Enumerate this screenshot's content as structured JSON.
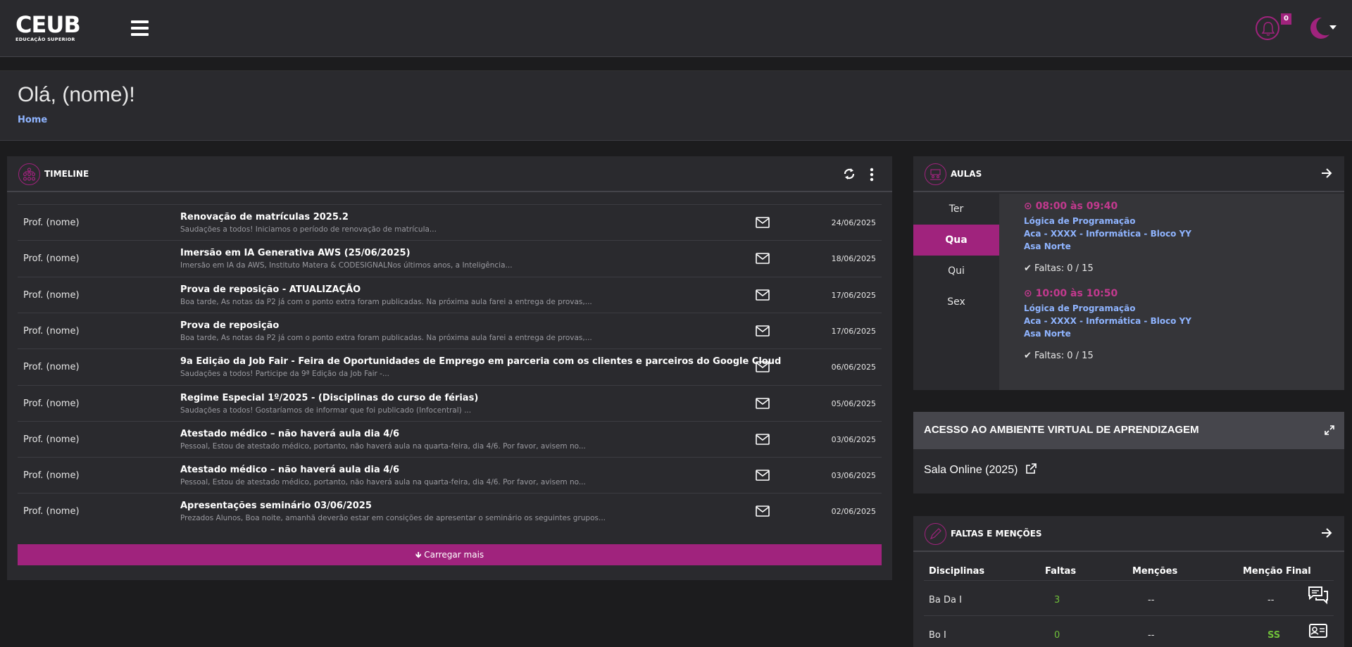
{
  "header": {
    "logo_text": "CEUB",
    "logo_subtitle": "EDUCAÇÃO SUPERIOR",
    "notification_count": "0",
    "colors": {
      "accent": "#a0237d",
      "link": "#8fb4ff",
      "green": "#6fbf3a"
    }
  },
  "page": {
    "greeting": "Olá, (nome)!",
    "breadcrumb": "Home"
  },
  "timeline": {
    "title": "TIMELINE",
    "load_more": "Carregar mais",
    "rows": [
      {
        "author": "Prof. (nome)",
        "subject": "Renovação de matrículas 2025.2",
        "preview": "Saudações a todos! Iniciamos o período de renovação de matrícula...",
        "date": "24/06/2025"
      },
      {
        "author": "Prof. (nome)",
        "subject": "Imersão em IA Generativa AWS (25/06/2025)",
        "preview": "Imersão em IA da AWS, Instituto Matera & CODESIGNALNos últimos anos, a Inteligência...",
        "date": "18/06/2025"
      },
      {
        "author": "Prof. (nome)",
        "subject": "Prova de reposição - ATUALIZAÇÃO",
        "preview": "Boa tarde, As notas da P2 já com o ponto extra foram publicadas. Na próxima aula farei a entrega de provas,...",
        "date": "17/06/2025"
      },
      {
        "author": "Prof. (nome)",
        "subject": "Prova de reposição",
        "preview": "Boa tarde, As notas da P2 já com o ponto extra foram publicadas. Na próxima aula farei a entrega de provas,...",
        "date": "17/06/2025"
      },
      {
        "author": "Prof. (nome)",
        "subject": "9a Edição da Job Fair - Feira de Oportunidades de Emprego em parceria com os clientes e parceiros do Google Cloud",
        "preview": "Saudações a todos!   Participe da 9ª Edição da Job Fair -...",
        "date": "06/06/2025"
      },
      {
        "author": "Prof. (nome)",
        "subject": "Regime Especial 1º/2025 - (Disciplinas do curso de férias)",
        "preview": "Saudações a todos! Gostaríamos de informar que foi publicado (Infocentral) ...",
        "date": "05/06/2025"
      },
      {
        "author": "Prof. (nome)",
        "subject": "Atestado médico – não haverá aula dia 4/6",
        "preview": "Pessoal, Estou de atestado médico, portanto, não haverá aula na quarta-feira, dia 4/6. Por favor, avisem no...",
        "date": "03/06/2025"
      },
      {
        "author": "Prof. (nome)",
        "subject": "Atestado médico – não haverá aula dia 4/6",
        "preview": "Pessoal, Estou de atestado médico, portanto, não haverá aula na quarta-feira, dia 4/6. Por favor, avisem no...",
        "date": "03/06/2025"
      },
      {
        "author": "Prof. (nome)",
        "subject": "Apresentações seminário 03/06/2025",
        "preview": "Prezados Alunos, Boa noite, amanhã deverão estar em consições de apresentar o seminário os seguintes grupos...",
        "date": "02/06/2025"
      }
    ]
  },
  "aulas": {
    "title": "AULAS",
    "days": [
      "Ter",
      "Qua",
      "Qui",
      "Sex"
    ],
    "selected_day": "Qua",
    "slots": [
      {
        "time": "08:00 às 09:40",
        "course": "Lógica de Programação",
        "room": "Aca - XXXX - Informática - Bloco YY",
        "campus": "Asa Norte",
        "faltas": "Faltas: 0 / 15"
      },
      {
        "time": "10:00 às 10:50",
        "course": "Lógica de Programação",
        "room": "Aca - XXXX - Informática - Bloco YY",
        "campus": "Asa Norte",
        "faltas": "Faltas: 0 / 15"
      }
    ]
  },
  "ava": {
    "title": "ACESSO AO AMBIENTE VIRTUAL DE APRENDIZAGEM",
    "link": "Sala Online (2025)"
  },
  "faltas": {
    "title": "FALTAS E MENÇÕES",
    "headers": [
      "Disciplinas",
      "Faltas",
      "Menções",
      "Menção Final"
    ],
    "rows": [
      {
        "disciplina": "Ba Da I",
        "faltas": "3",
        "mencoes": "--",
        "final": "--"
      },
      {
        "disciplina": "Bo I",
        "faltas": "0",
        "mencoes": "--",
        "final": "SS"
      }
    ]
  }
}
